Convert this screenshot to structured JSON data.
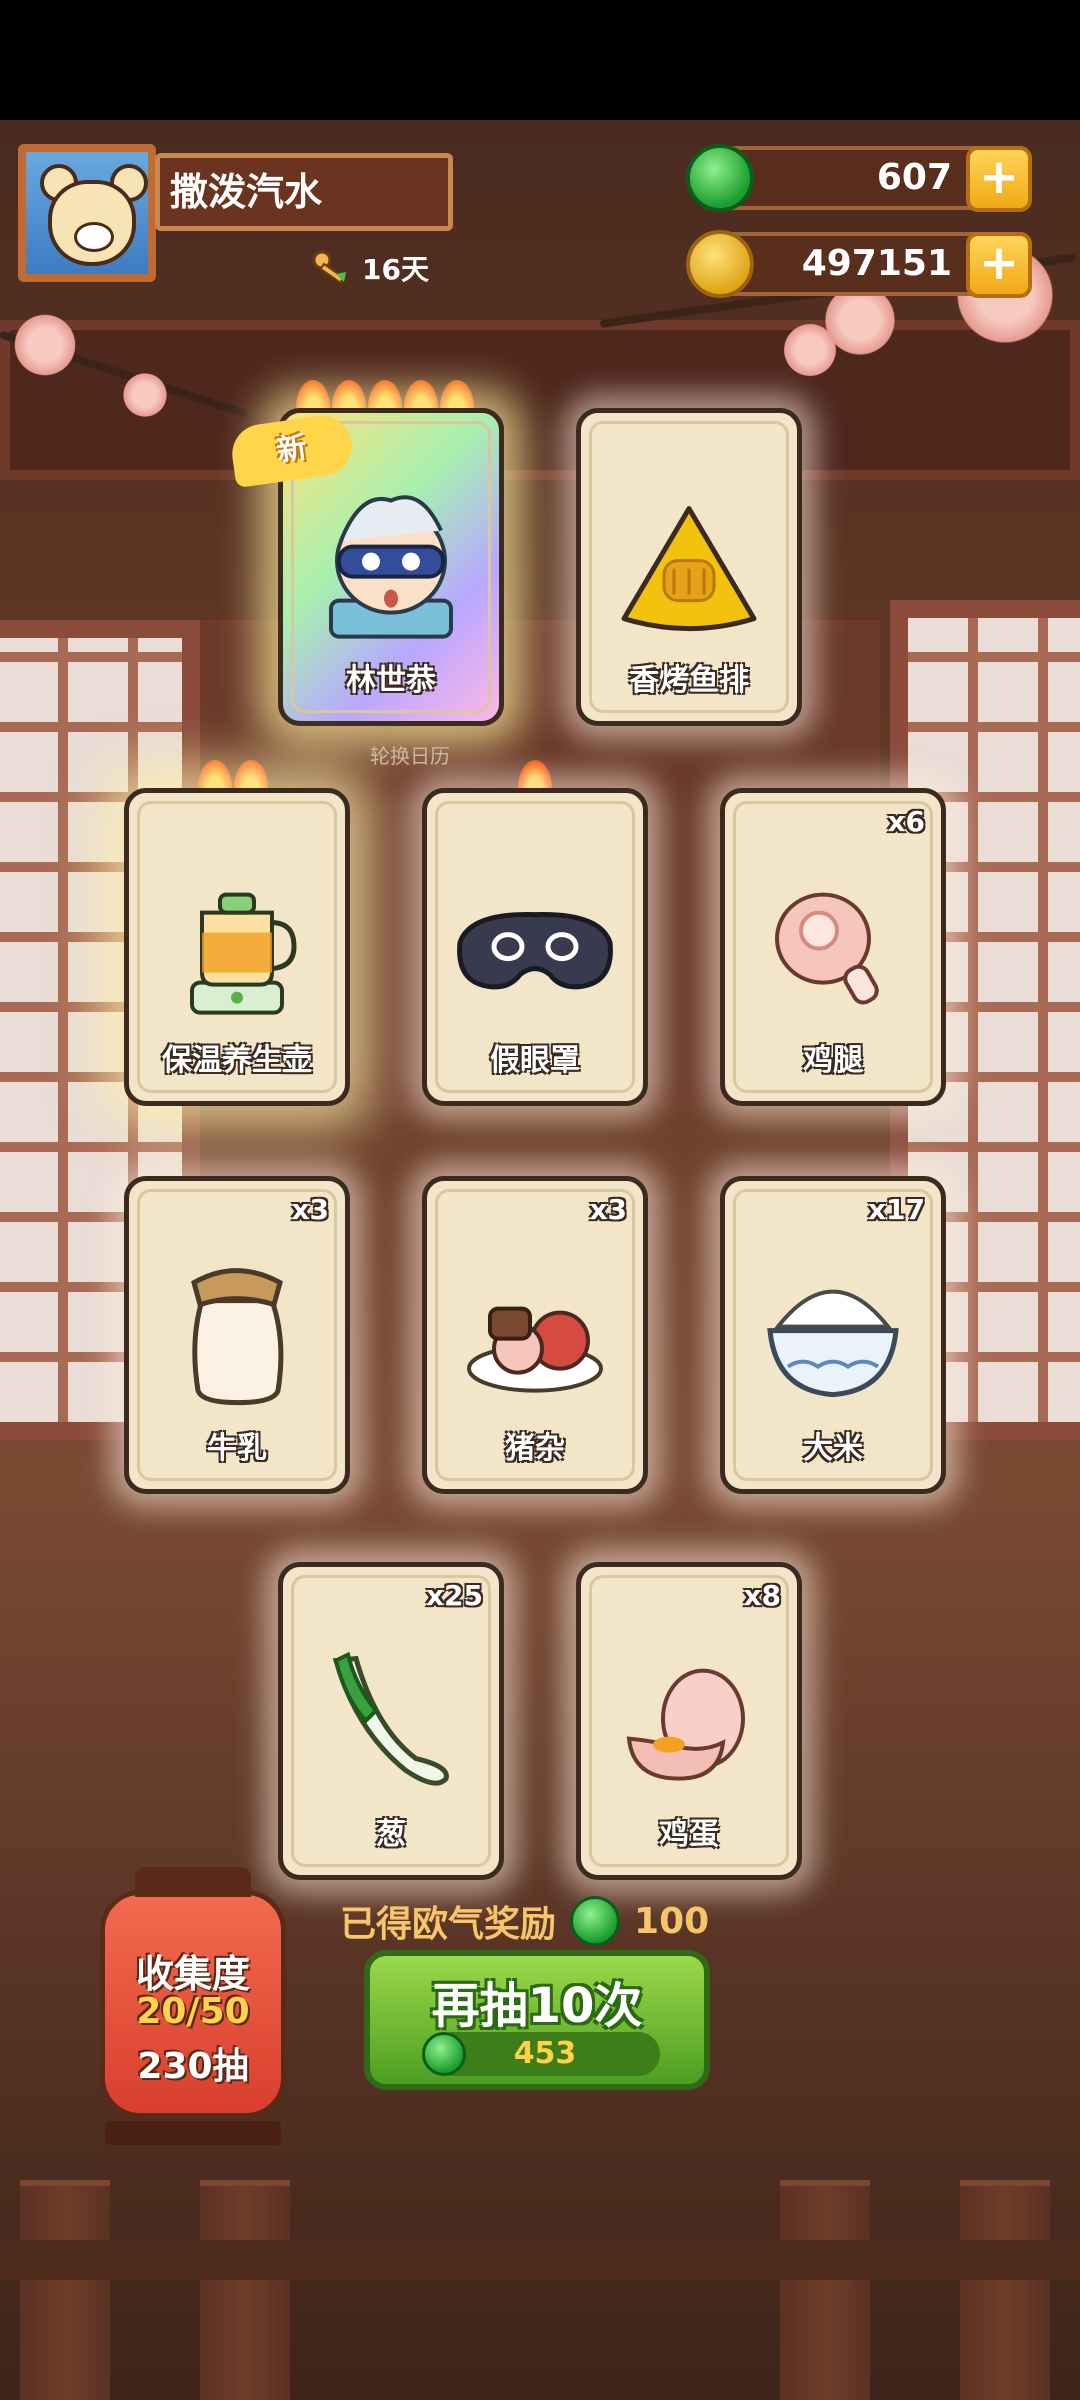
{
  "player": {
    "name": "撒泼汽水",
    "days": "16天"
  },
  "resources": {
    "jade": "607",
    "coins": "497151"
  },
  "new_badge": "新",
  "calendar_label": "轮换日历",
  "cards": [
    {
      "name": "林世恭",
      "qty": "",
      "flames": 5,
      "art": "sleeping-boy-icon"
    },
    {
      "name": "香烤鱼排",
      "qty": "",
      "flames": 0,
      "art": "fish-fillet-icon"
    },
    {
      "name": "保温养生壶",
      "qty": "",
      "flames": 2,
      "art": "teapot-icon"
    },
    {
      "name": "假眼罩",
      "qty": "",
      "flames": 1,
      "art": "eye-mask-icon"
    },
    {
      "name": "鸡腿",
      "qty": "x6",
      "flames": 0,
      "art": "drumstick-icon"
    },
    {
      "name": "牛乳",
      "qty": "x3",
      "flames": 0,
      "art": "milk-jar-icon"
    },
    {
      "name": "猪杂",
      "qty": "x3",
      "flames": 0,
      "art": "pork-offal-icon"
    },
    {
      "name": "大米",
      "qty": "x17",
      "flames": 0,
      "art": "rice-bowl-icon"
    },
    {
      "name": "葱",
      "qty": "x25",
      "flames": 0,
      "art": "scallion-icon"
    },
    {
      "name": "鸡蛋",
      "qty": "x8",
      "flames": 0,
      "art": "egg-icon"
    }
  ],
  "reward": {
    "label": "已得欧气奖励",
    "value": "100"
  },
  "redraw": {
    "label": "再抽10次",
    "cost": "453"
  },
  "collection": {
    "label": "收集度",
    "progress": "20/50",
    "draws": "230抽"
  }
}
